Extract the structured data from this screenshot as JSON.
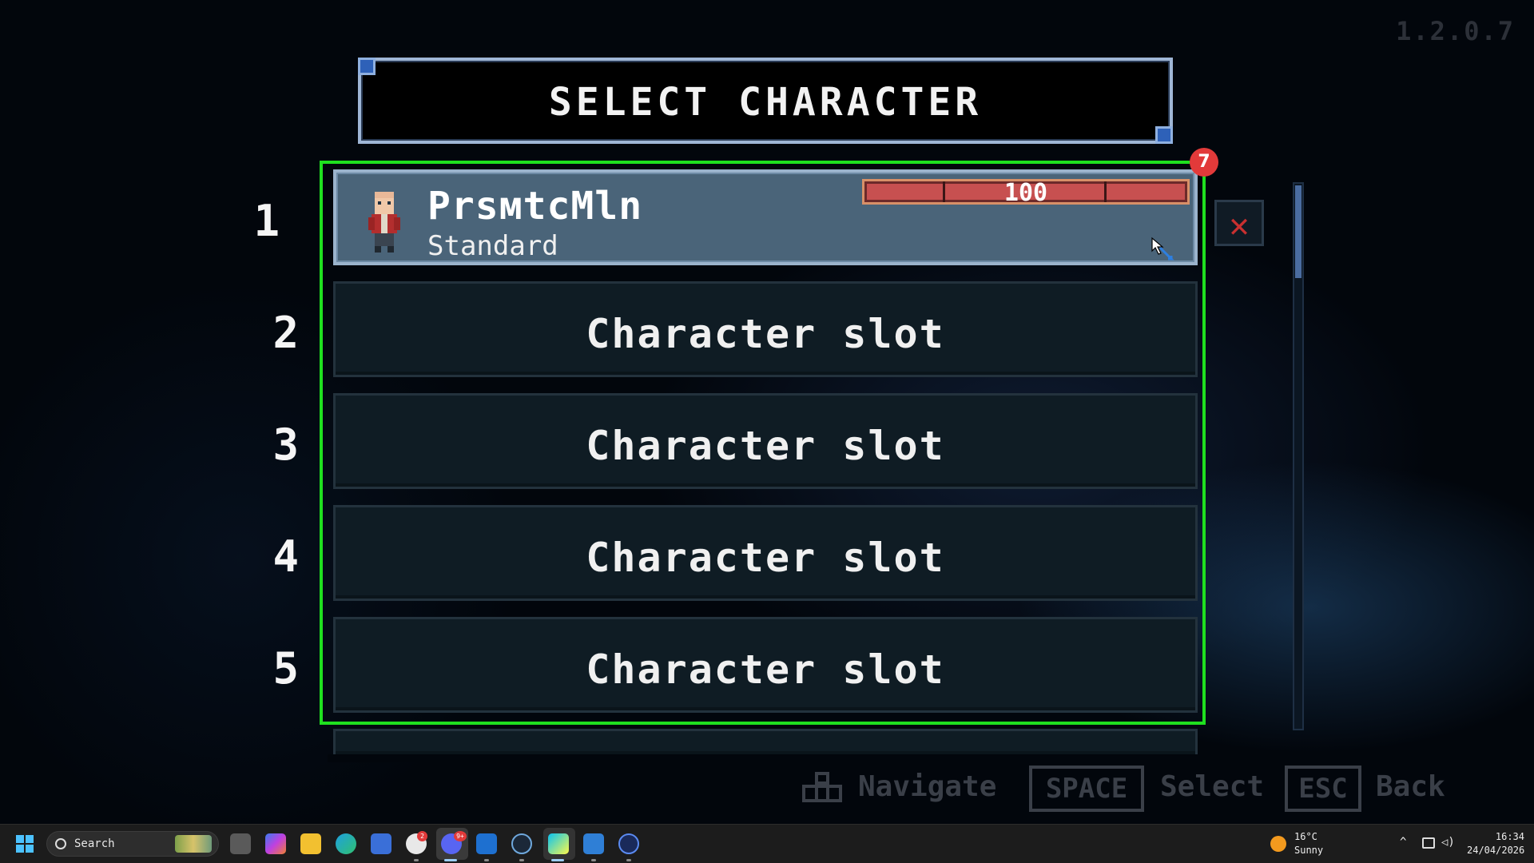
{
  "game": {
    "version": "1.2.0.7",
    "title": "SELECT CHARACTER",
    "notification_count": "7",
    "slots": [
      {
        "number": "1",
        "name": "PrsмtcMln",
        "type": "Standard",
        "hp": 100,
        "hp_max": 100,
        "hp_label": "100"
      },
      {
        "number": "2",
        "label": "Character slot"
      },
      {
        "number": "3",
        "label": "Character slot"
      },
      {
        "number": "4",
        "label": "Character slot"
      },
      {
        "number": "5",
        "label": "Character slot"
      }
    ],
    "close_icon": "close-icon",
    "hints": {
      "navigate": "Navigate",
      "space_key": "SPACE",
      "select": "Select",
      "esc_key": "ESC",
      "back": "Back"
    },
    "colors": {
      "selection_frame": "#1fe01f",
      "active_slot": "#4a6479",
      "empty_slot": "#0f1c24",
      "hp_fill": "#c75050",
      "close": "#c93030"
    }
  },
  "taskbar": {
    "search_placeholder": "Search",
    "steam_badge": "2",
    "discord_badge": "9+",
    "weather_temp": "16°C",
    "weather_desc": "Sunny",
    "time": "16:34",
    "date": "24/04/2026"
  }
}
